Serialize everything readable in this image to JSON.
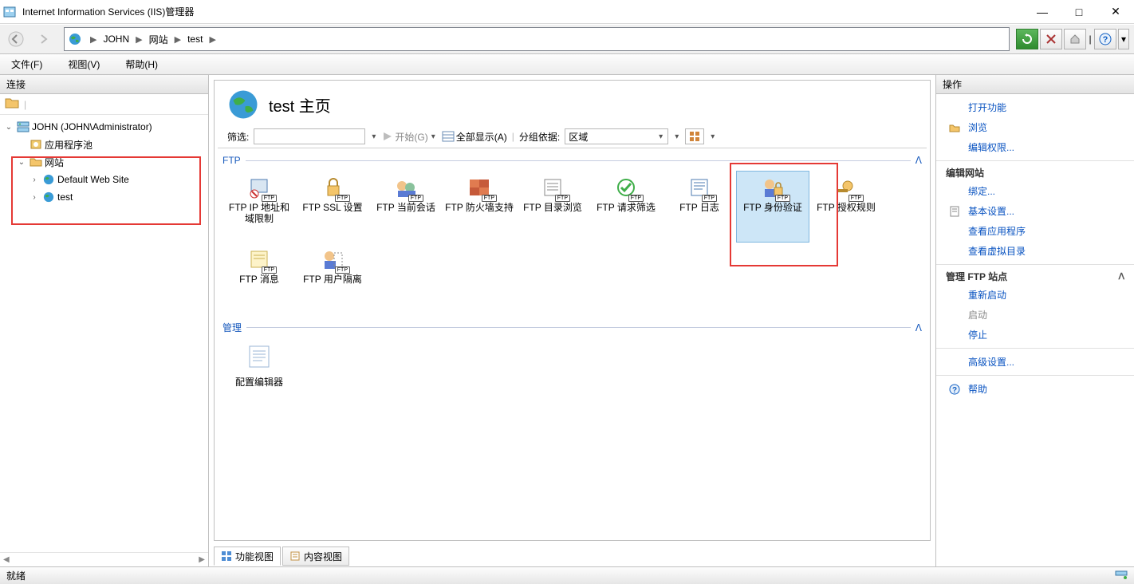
{
  "window": {
    "title": "Internet Information Services (IIS)管理器"
  },
  "breadcrumb": {
    "segments": [
      "JOHN",
      "网站",
      "test"
    ]
  },
  "menubar": {
    "file": "文件(F)",
    "view": "视图(V)",
    "help": "帮助(H)"
  },
  "connections": {
    "title": "连接",
    "root": "JOHN (JOHN\\Administrator)",
    "app_pools": "应用程序池",
    "sites": "网站",
    "site_default": "Default Web Site",
    "site_test": "test"
  },
  "main": {
    "heading": "test 主页",
    "filter_label": "筛选:",
    "start_label": "开始(G)",
    "showall_label": "全部显示(A)",
    "group_label": "分组依据:",
    "group_value": "区域",
    "section_ftp": "FTP",
    "section_mgmt": "管理",
    "ftp_items": [
      "FTP IP 地址和域限制",
      "FTP SSL 设置",
      "FTP 当前会话",
      "FTP 防火墙支持",
      "FTP 目录浏览",
      "FTP 请求筛选",
      "FTP 日志",
      "FTP 身份验证",
      "FTP 授权规则",
      "FTP 消息",
      "FTP 用户隔离"
    ],
    "cfg_editor": "配置编辑器",
    "tab_features": "功能视图",
    "tab_content": "内容视图"
  },
  "actions": {
    "title": "操作",
    "open_feature": "打开功能",
    "browse": "浏览",
    "edit_perm": "编辑权限...",
    "edit_site_head": "编辑网站",
    "bindings": "绑定...",
    "basic": "基本设置...",
    "view_apps": "查看应用程序",
    "view_vdir": "查看虚拟目录",
    "manage_ftp_head": "管理 FTP 站点",
    "restart": "重新启动",
    "start": "启动",
    "stop": "停止",
    "advanced": "高级设置...",
    "help": "帮助"
  },
  "status": {
    "ready": "就绪"
  }
}
